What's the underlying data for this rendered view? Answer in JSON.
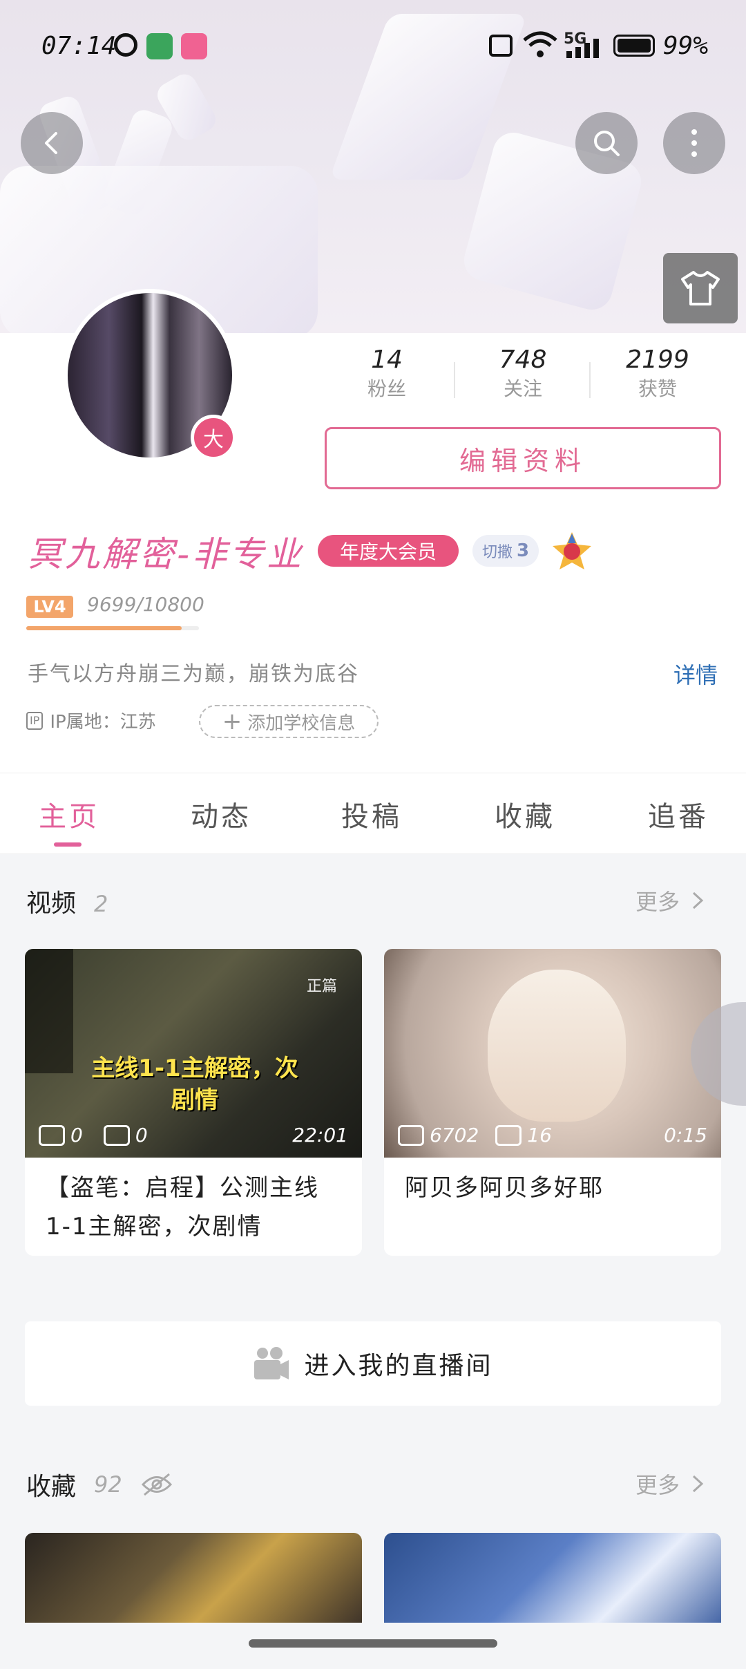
{
  "status_bar": {
    "time": "07:14",
    "network": "5G",
    "battery": "99%"
  },
  "header": {
    "back_icon": "back-icon",
    "search_icon": "search-icon",
    "more_icon": "more-icon",
    "skin_icon": "shirt-icon"
  },
  "profile": {
    "avatar_badge": "大",
    "stats": [
      {
        "value": "14",
        "label": "粉丝"
      },
      {
        "value": "748",
        "label": "关注"
      },
      {
        "value": "2199",
        "label": "获赞"
      }
    ],
    "edit_button": "编辑资料",
    "username": "冥九解密-非专业",
    "vip_badge": "年度大会员",
    "fans_badge_text": "切撒",
    "fans_badge_level": "3",
    "level": "LV4",
    "exp": "9699/10800",
    "exp_fraction": 0.898,
    "bio": "手气以方舟崩三为巅，崩铁为底谷",
    "detail_link": "详情",
    "ip_tag": "IP",
    "ip_location": "IP属地：江苏",
    "add_school": "添加学校信息"
  },
  "tabs": [
    "主页",
    "动态",
    "投稿",
    "收藏",
    "追番"
  ],
  "videos": {
    "title": "视频",
    "count": "2",
    "more": "更多",
    "items": [
      {
        "plays": "0",
        "danmaku": "0",
        "duration": "22:01",
        "title": "【盗笔：启程】公测主线1-1主解密，次剧情",
        "overlay_text": "主线1-1主解密，次剧情",
        "overlay_corner": "正篇"
      },
      {
        "plays": "6702",
        "danmaku": "16",
        "duration": "0:15",
        "title": "阿贝多阿贝多好耶"
      }
    ]
  },
  "live_button": "进入我的直播间",
  "favorites": {
    "title": "收藏",
    "count": "92",
    "more": "更多"
  }
}
